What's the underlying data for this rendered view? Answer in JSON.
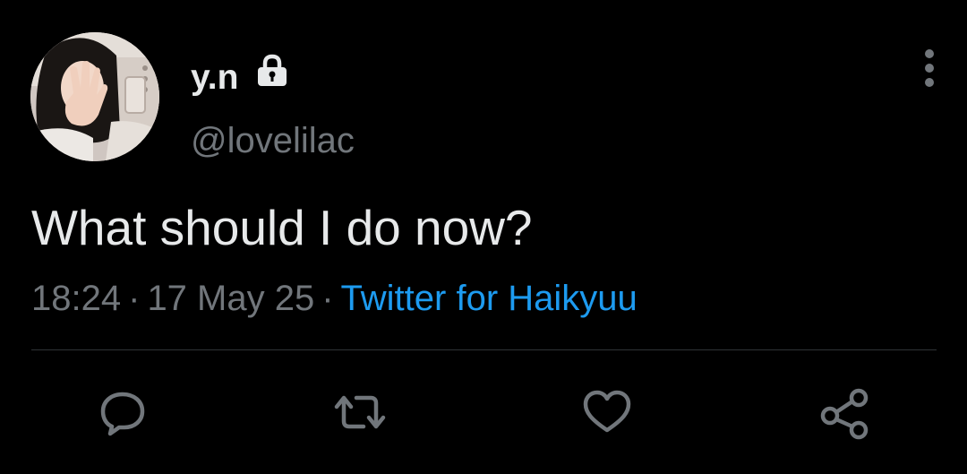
{
  "tweet": {
    "author": {
      "display_name": "y.n",
      "handle": "@lovelilac",
      "avatar_icon": "avatar-photo",
      "protected_icon": "lock-icon"
    },
    "text": "What should I do now?",
    "meta": {
      "time": "18:24",
      "separator": "·",
      "date": "17 May 25",
      "source": "Twitter for Haikyuu"
    },
    "menu_icon": "more-vertical-icon",
    "actions": [
      {
        "name": "reply",
        "icon": "reply-icon"
      },
      {
        "name": "retweet",
        "icon": "retweet-icon"
      },
      {
        "name": "like",
        "icon": "heart-icon"
      },
      {
        "name": "share",
        "icon": "share-icon"
      }
    ]
  },
  "colors": {
    "background": "#000000",
    "primary_text": "#e7e9ea",
    "secondary_text": "#71767b",
    "link": "#1d9bf0",
    "divider": "#2f3336"
  }
}
